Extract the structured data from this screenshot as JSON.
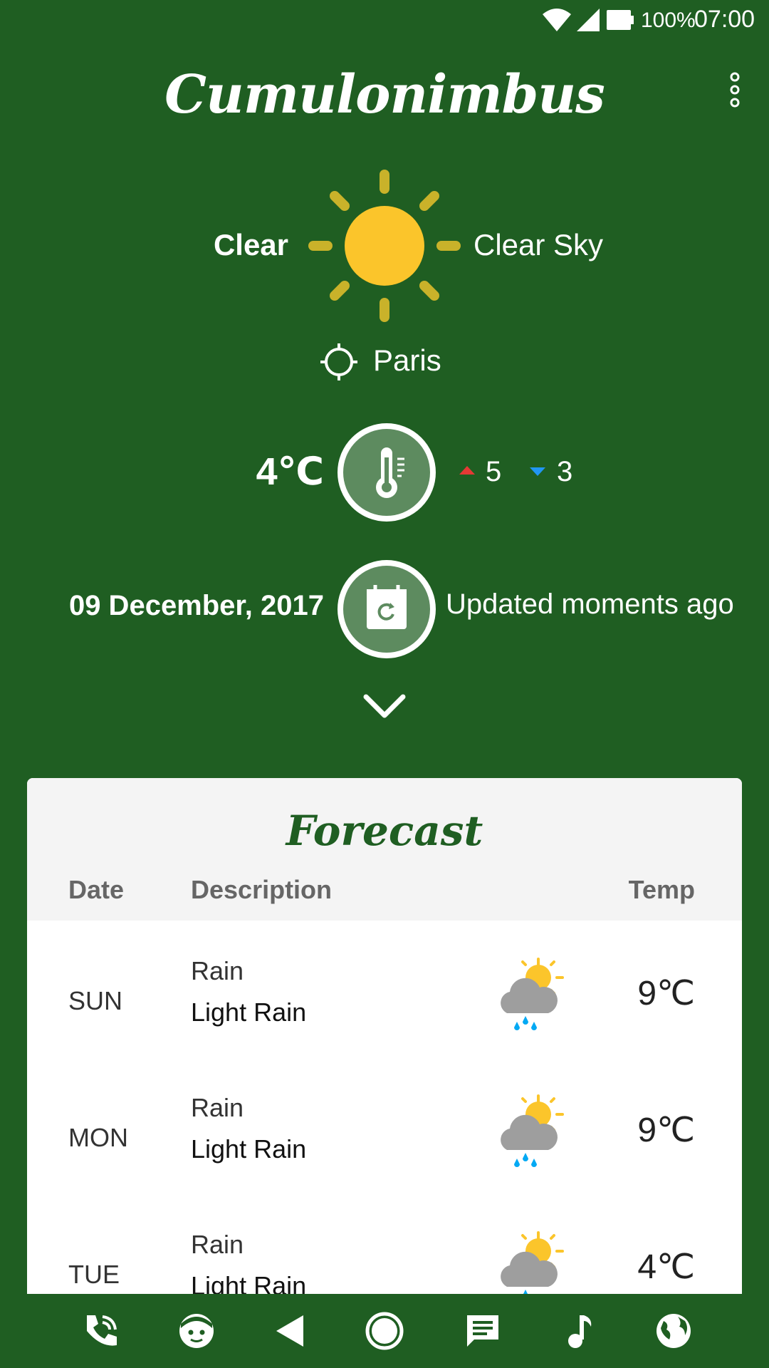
{
  "status_bar": {
    "battery": "100%",
    "time": "07:00"
  },
  "app": {
    "title": "Cumulonimbus",
    "menu_icon": "more-vert-icon"
  },
  "current": {
    "condition": "Clear",
    "description": "Clear Sky",
    "location": "Paris",
    "temperature": "4℃",
    "high": "5",
    "low": "3",
    "date": "09 December, 2017",
    "updated": "Updated moments ago",
    "colors": {
      "sun": "#fbc52b",
      "rays": "#c9b22a",
      "high_arrow": "#e53935",
      "low_arrow": "#2196f3"
    }
  },
  "forecast": {
    "title": "Forecast",
    "headers": {
      "date": "Date",
      "description": "Description",
      "temp": "Temp"
    },
    "rows": [
      {
        "day": "SUN",
        "main": "Rain",
        "desc": "Light Rain",
        "temp": "9℃",
        "icon": "rain-sun-icon"
      },
      {
        "day": "MON",
        "main": "Rain",
        "desc": "Light Rain",
        "temp": "9℃",
        "icon": "rain-sun-icon"
      },
      {
        "day": "TUE",
        "main": "Rain",
        "desc": "Light Rain",
        "temp": "4℃",
        "icon": "rain-sun-icon"
      }
    ]
  },
  "nav": [
    "phone-icon",
    "face-icon",
    "back-icon",
    "home-icon",
    "message-icon",
    "music-icon",
    "globe-icon"
  ],
  "theme": {
    "primary": "#1f5e22",
    "card": "#ffffff",
    "card_header": "#f4f4f4"
  }
}
